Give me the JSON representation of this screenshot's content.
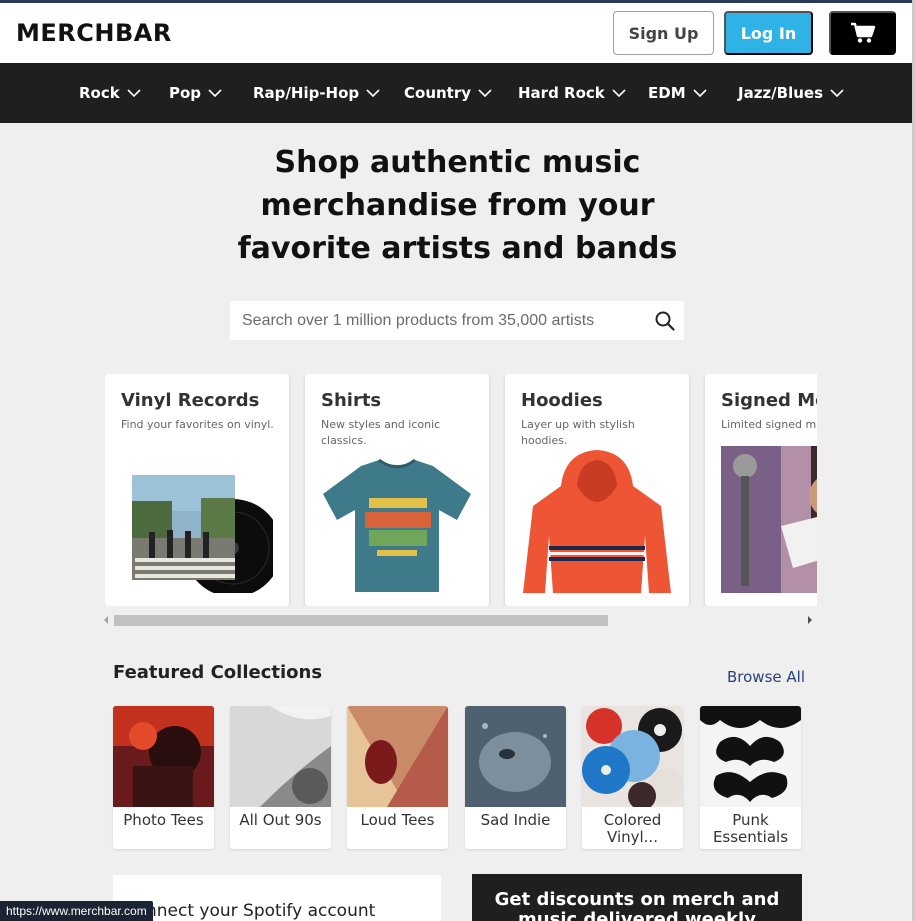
{
  "header": {
    "logo": "MERCHBAR",
    "signup_label": "Sign Up",
    "login_label": "Log In",
    "cart_icon": "cart-icon"
  },
  "nav": {
    "genres": [
      {
        "label": "Rock"
      },
      {
        "label": "Pop"
      },
      {
        "label": "Rap/Hip-Hop"
      },
      {
        "label": "Country"
      },
      {
        "label": "Hard Rock"
      },
      {
        "label": "EDM"
      },
      {
        "label": "Jazz/Blues"
      }
    ]
  },
  "hero": {
    "title": "Shop authentic music merchandise from your favorite artists and bands"
  },
  "search": {
    "placeholder": "Search over 1 million products from 35,000 artists",
    "icon": "search-icon"
  },
  "categories": [
    {
      "title": "Vinyl Records",
      "desc": "Find your favorites on vinyl."
    },
    {
      "title": "Shirts",
      "desc": "New styles and iconic classics."
    },
    {
      "title": "Hoodies",
      "desc": "Layer up with stylish hoodies."
    },
    {
      "title": "Signed Me",
      "desc": "Limited signed me vinyl"
    }
  ],
  "featured": {
    "title": "Featured Collections",
    "browse_label": "Browse All",
    "collections": [
      {
        "label": "Photo Tees"
      },
      {
        "label": "All Out 90s"
      },
      {
        "label": "Loud Tees"
      },
      {
        "label": "Sad Indie"
      },
      {
        "label": "Colored Vinyl..."
      },
      {
        "label": "Punk Essentials"
      }
    ]
  },
  "spotify": {
    "text": "nnect your Spotify account"
  },
  "promo": {
    "text": "Get discounts on merch and music delivered weekly"
  },
  "statusbar": {
    "url": "https://www.merchbar.com"
  },
  "colors": {
    "accent": "#2fb3e6",
    "nav_bg": "#1f1f1f",
    "page_bg": "#efefef",
    "link": "#2a3f7a"
  }
}
